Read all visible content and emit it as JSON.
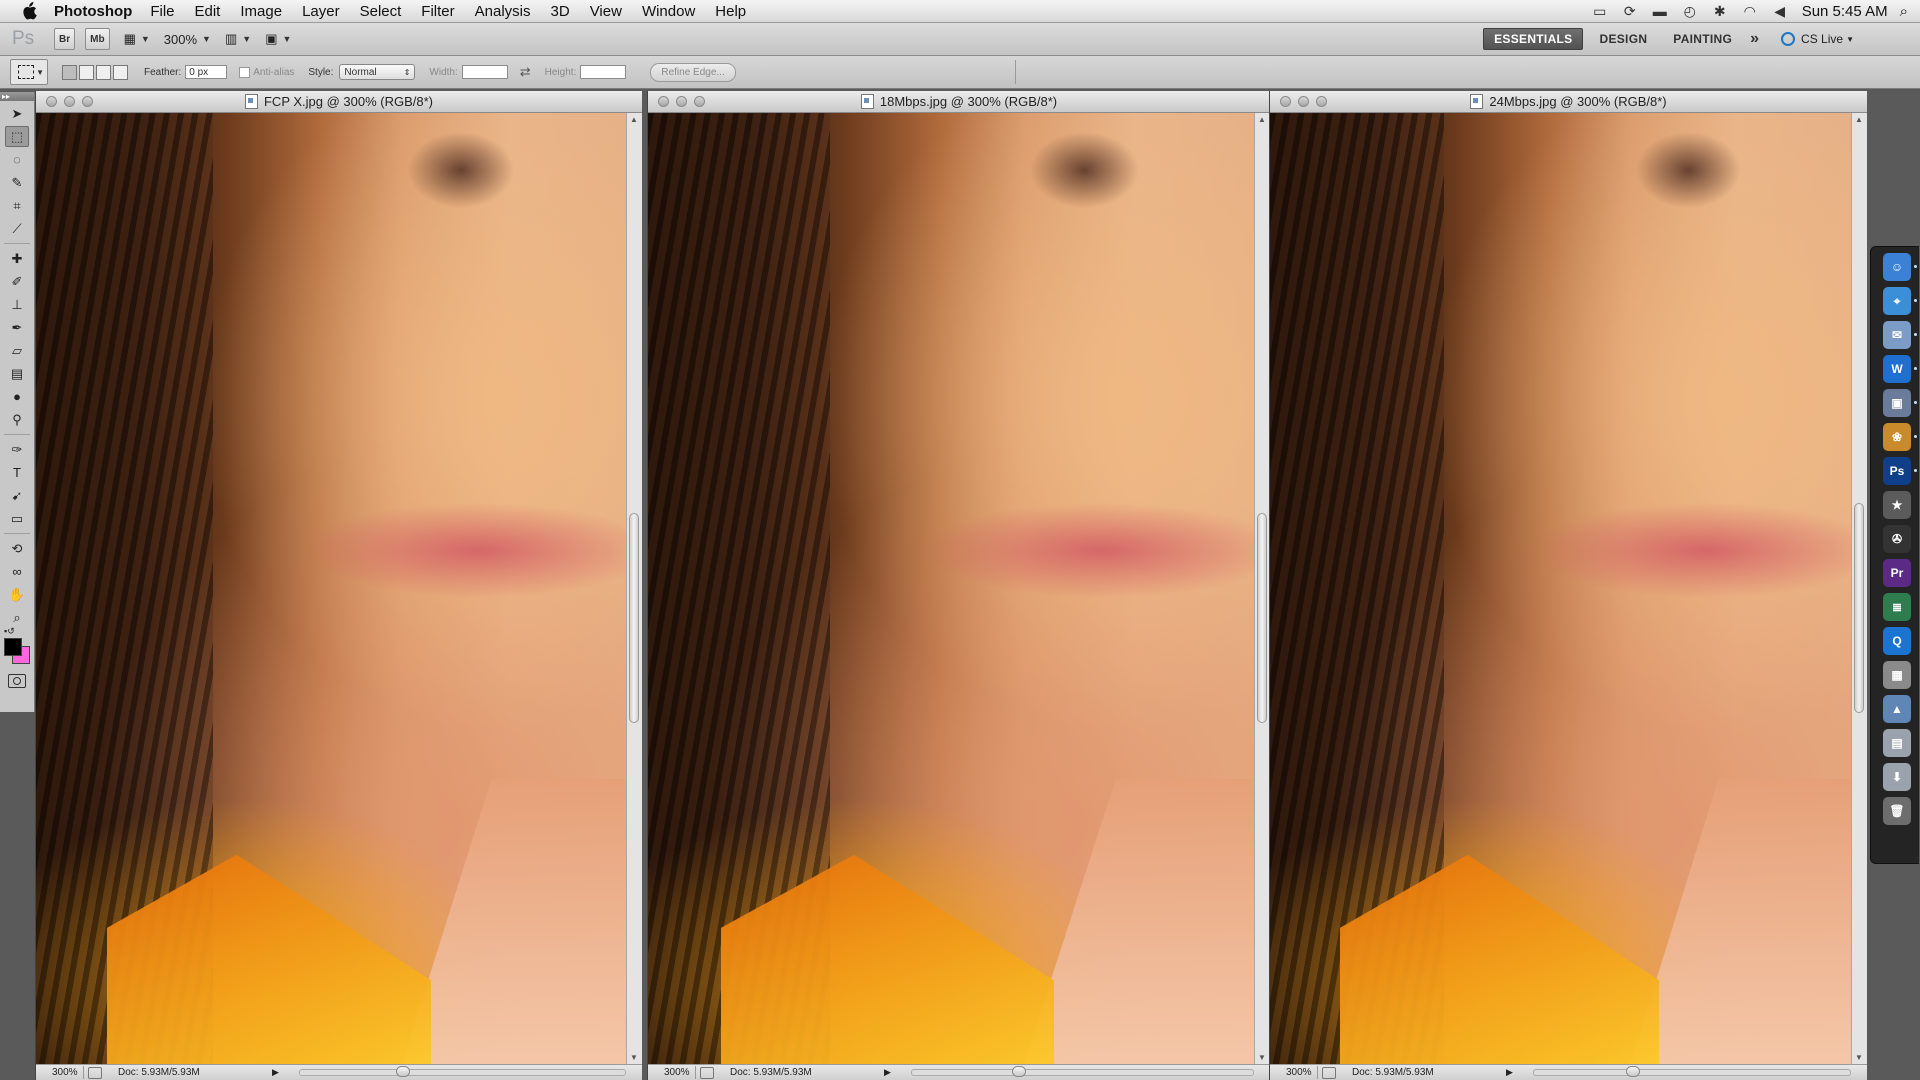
{
  "menubar": {
    "app_name": "Photoshop",
    "menus": [
      "File",
      "Edit",
      "Image",
      "Layer",
      "Select",
      "Filter",
      "Analysis",
      "3D",
      "View",
      "Window",
      "Help"
    ],
    "clock": "Sun 5:45 AM"
  },
  "appbar": {
    "ps_logo": "Ps",
    "bridge_label": "Br",
    "minibridge_label": "Mb",
    "zoom_value": "300%",
    "workspaces": [
      "ESSENTIALS",
      "DESIGN",
      "PAINTING"
    ],
    "active_workspace": "ESSENTIALS",
    "more": "»",
    "cs_live": "CS Live"
  },
  "options": {
    "feather_label": "Feather:",
    "feather_value": "0 px",
    "antialias_label": "Anti-alias",
    "style_label": "Style:",
    "style_value": "Normal",
    "width_label": "Width:",
    "height_label": "Height:",
    "refine_label": "Refine Edge..."
  },
  "documents": [
    {
      "title": "FCP X.jpg @ 300% (RGB/8*)",
      "zoom": "300%",
      "doc_info": "Doc: 5.93M/5.93M"
    },
    {
      "title": "18Mbps.jpg @ 300% (RGB/8*)",
      "zoom": "300%",
      "doc_info": "Doc: 5.93M/5.93M"
    },
    {
      "title": "24Mbps.jpg @ 300% (RGB/8*)",
      "zoom": "300%",
      "doc_info": "Doc: 5.93M/5.93M"
    }
  ],
  "dock_items": [
    {
      "name": "Finder",
      "glyph": "☺",
      "color": "#3b82d6"
    },
    {
      "name": "Safari",
      "glyph": "⌖",
      "color": "#3a8fd8"
    },
    {
      "name": "Mail",
      "glyph": "✉",
      "color": "#7a9cc6"
    },
    {
      "name": "Word",
      "glyph": "W",
      "color": "#1f6fd0"
    },
    {
      "name": "Preview",
      "glyph": "▣",
      "color": "#6a7c99"
    },
    {
      "name": "iPhoto",
      "glyph": "❀",
      "color": "#c98a2c"
    },
    {
      "name": "Photoshop",
      "glyph": "Ps",
      "color": "#0f3f8a"
    },
    {
      "name": "iMovie",
      "glyph": "★",
      "color": "#5b5b5b"
    },
    {
      "name": "Final Cut",
      "glyph": "✇",
      "color": "#333"
    },
    {
      "name": "Premiere",
      "glyph": "Pr",
      "color": "#5b2a86"
    },
    {
      "name": "Stacks",
      "glyph": "≣",
      "color": "#2e7d4f"
    },
    {
      "name": "QuickTime",
      "glyph": "Q",
      "color": "#1b74d1"
    },
    {
      "name": "Calculator",
      "glyph": "▦",
      "color": "#8a8a8a"
    },
    {
      "name": "Applications",
      "glyph": "▲",
      "color": "#5f86b4"
    },
    {
      "name": "Documents",
      "glyph": "▤",
      "color": "#9aa3ad"
    },
    {
      "name": "Downloads",
      "glyph": "⬇",
      "color": "#9aa3ad"
    },
    {
      "name": "Trash",
      "glyph": "🗑",
      "color": "#6d6d6d"
    }
  ],
  "colors": {
    "foreground": "#000000",
    "background": "#ff66d9",
    "active_workspace_bg": "#5e5e5e"
  }
}
